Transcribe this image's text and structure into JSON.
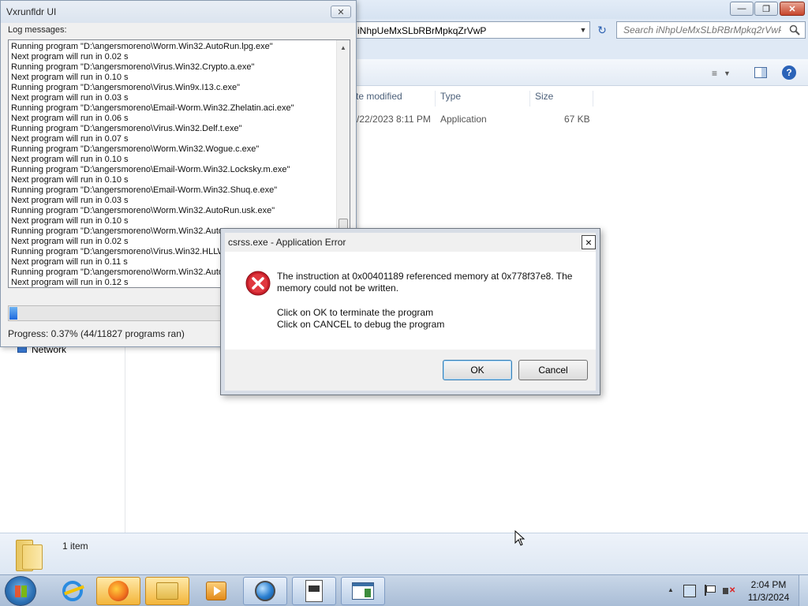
{
  "explorer": {
    "address": "iNhpUeMxSLbRBrMpkqZrVwP",
    "search_placeholder": "Search iNhpUeMxSLbRBrMpkq2rVwP",
    "columns": {
      "date": "te modified",
      "type": "Type",
      "size": "Size"
    },
    "file": {
      "date": "/22/2023 8:11 PM",
      "type": "Application",
      "size": "67 KB"
    },
    "nav_network": "Network",
    "status": "1 item"
  },
  "vx": {
    "title": "Vxrunfldr UI",
    "log_label": "Log messages:",
    "log_lines": [
      "Running program \"D:\\angersmoreno\\Worm.Win32.AutoRun.lpg.exe\"",
      "Next program will run in 0.02 s",
      "Running program \"D:\\angersmoreno\\Virus.Win32.Crypto.a.exe\"",
      "Next program will run in 0.10 s",
      "Running program \"D:\\angersmoreno\\Virus.Win9x.I13.c.exe\"",
      "Next program will run in 0.03 s",
      "Running program \"D:\\angersmoreno\\Email-Worm.Win32.Zhelatin.aci.exe\"",
      "Next program will run in 0.06 s",
      "Running program \"D:\\angersmoreno\\Virus.Win32.Delf.t.exe\"",
      "Next program will run in 0.07 s",
      "Running program \"D:\\angersmoreno\\Worm.Win32.Wogue.c.exe\"",
      "Next program will run in 0.10 s",
      "Running program \"D:\\angersmoreno\\Email-Worm.Win32.Locksky.m.exe\"",
      "Next program will run in 0.10 s",
      "Running program \"D:\\angersmoreno\\Email-Worm.Win32.Shuq.e.exe\"",
      "Next program will run in 0.03 s",
      "Running program \"D:\\angersmoreno\\Worm.Win32.AutoRun.usk.exe\"",
      "Next program will run in 0.10 s",
      "Running program \"D:\\angersmoreno\\Worm.Win32.Auto",
      "Next program will run in 0.02 s",
      "Running program \"D:\\angersmoreno\\Virus.Win32.HLLW",
      "Next program will run in 0.11 s",
      "Running program \"D:\\angersmoreno\\Worm.Win32.Auto",
      "Next program will run in 0.12 s"
    ],
    "progress_fraction": 0.0037,
    "progress_text": "Progress: 0.37% (44/11827 programs ran)"
  },
  "dialog": {
    "title": "csrss.exe - Application Error",
    "message": "The instruction at 0x00401189 referenced memory at 0x778f37e8. The memory could not be written.",
    "line_ok": "Click on OK to terminate the program",
    "line_cancel": "Click on CANCEL to debug the program",
    "ok_label": "OK",
    "cancel_label": "Cancel"
  },
  "taskbar": {
    "items": [
      "internet-explorer",
      "firefox",
      "windows-explorer",
      "media-player",
      "browser-globe",
      "document-app",
      "window-app"
    ],
    "active": "windows-explorer",
    "time": "2:04 PM",
    "date": "11/3/2024"
  },
  "colors": {
    "progress": "#1e69de",
    "error": "#c8202b",
    "taskbar": "#b9cbe1"
  }
}
